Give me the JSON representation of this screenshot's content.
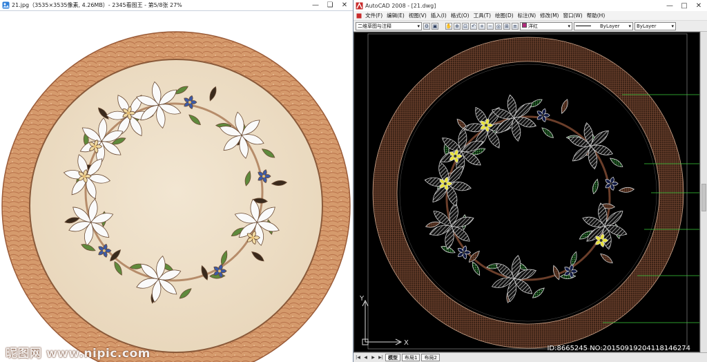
{
  "viewer": {
    "title": "21.jpg（3535×3535像素, 4.26MB）- 2345看图王 - 第5/8张 27%",
    "window_buttons": {
      "minimize": "—",
      "restore": "❏",
      "close": "✕"
    }
  },
  "cad": {
    "title": "AutoCAD 2008 - [21.dwg]",
    "window_buttons": {
      "minimize": "—",
      "maximize": "□",
      "close": "✕"
    },
    "menu": [
      "文件(F)",
      "编辑(E)",
      "视图(V)",
      "插入(I)",
      "格式(O)",
      "工具(T)",
      "绘图(D)",
      "标注(N)",
      "修改(M)",
      "窗口(W)",
      "帮助(H)"
    ],
    "workspace_combo": "二维草图与注释",
    "layer_combo": "洋红",
    "layer_color": "#b3297c",
    "linetype_combo": "ByLayer",
    "lineweight_combo": "ByLayer",
    "tabs": [
      "模型",
      "布局1",
      "布局2"
    ],
    "ucs_x": "X",
    "ucs_y": "Y"
  },
  "watermarks": {
    "left": "昵图网 www.nipic.com",
    "right": "ID:8665245 NO:20150919204118146274"
  },
  "icons": [
    "viewer-app-icon",
    "cad-app-icon",
    "zoom-icons",
    "ucs-icon",
    "tab-nav-icons"
  ]
}
